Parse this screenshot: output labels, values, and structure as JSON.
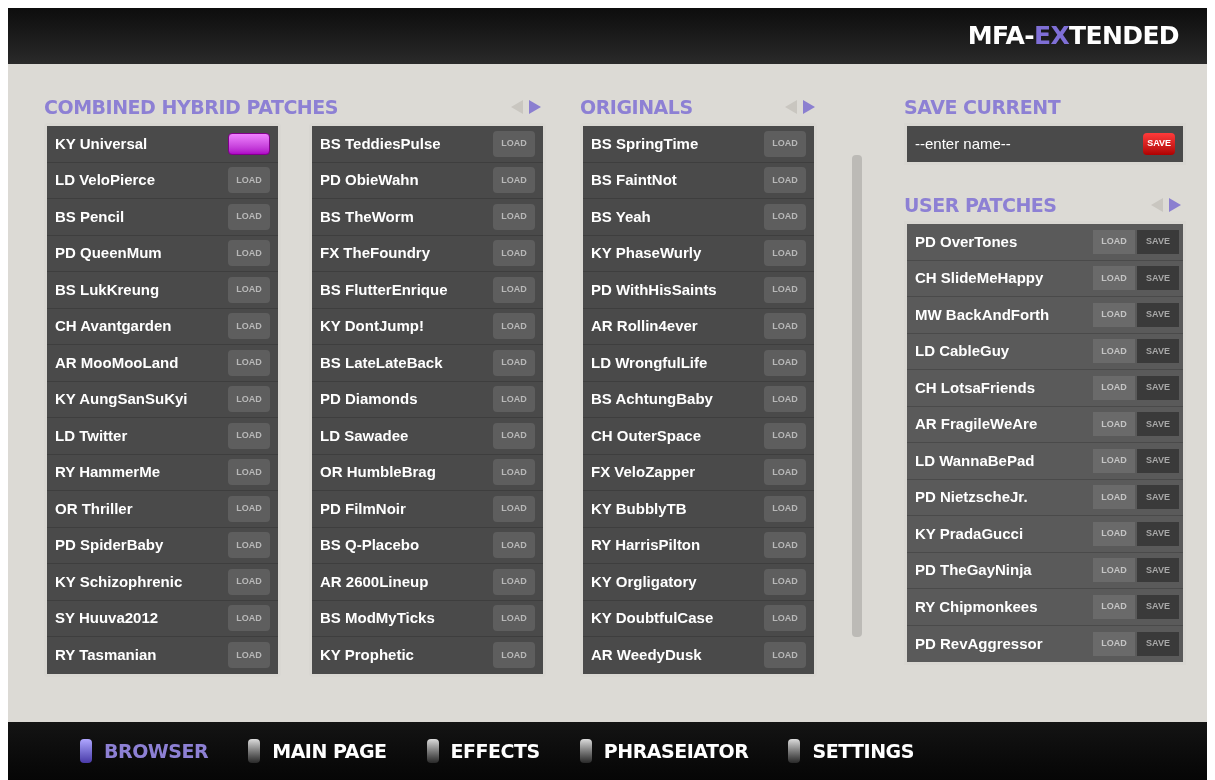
{
  "brand": {
    "prefix": "MFA-",
    "highlight": "EX",
    "suffix": "TENDED"
  },
  "combined": {
    "title": "COMBINED HYBRID PATCHES",
    "columns": [
      [
        {
          "name": "KY Universal",
          "selected": true
        },
        {
          "name": "LD VeloPierce",
          "selected": false,
          "load": "LOAD"
        },
        {
          "name": "BS Pencil",
          "selected": false,
          "load": "LOAD"
        },
        {
          "name": "PD QueenMum",
          "selected": false,
          "load": "LOAD"
        },
        {
          "name": "BS LukKreung",
          "selected": false,
          "load": "LOAD"
        },
        {
          "name": "CH Avantgarden",
          "selected": false,
          "load": "LOAD"
        },
        {
          "name": "AR MooMooLand",
          "selected": false,
          "load": "LOAD"
        },
        {
          "name": "KY AungSanSuKyi",
          "selected": false,
          "load": "LOAD"
        },
        {
          "name": "LD Twitter",
          "selected": false,
          "load": "LOAD"
        },
        {
          "name": "RY HammerMe",
          "selected": false,
          "load": "LOAD"
        },
        {
          "name": "OR Thriller",
          "selected": false,
          "load": "LOAD"
        },
        {
          "name": "PD SpiderBaby",
          "selected": false,
          "load": "LOAD"
        },
        {
          "name": "KY Schizophrenic",
          "selected": false,
          "load": "LOAD"
        },
        {
          "name": "SY Huuva2012",
          "selected": false,
          "load": "LOAD"
        },
        {
          "name": "RY Tasmanian",
          "selected": false,
          "load": "LOAD"
        }
      ],
      [
        {
          "name": "BS TeddiesPulse",
          "selected": false,
          "load": "LOAD"
        },
        {
          "name": "PD ObieWahn",
          "selected": false,
          "load": "LOAD"
        },
        {
          "name": "BS TheWorm",
          "selected": false,
          "load": "LOAD"
        },
        {
          "name": "FX TheFoundry",
          "selected": false,
          "load": "LOAD"
        },
        {
          "name": "BS FlutterEnrique",
          "selected": false,
          "load": "LOAD"
        },
        {
          "name": "KY DontJump!",
          "selected": false,
          "load": "LOAD"
        },
        {
          "name": "BS LateLateBack",
          "selected": false,
          "load": "LOAD"
        },
        {
          "name": "PD Diamonds",
          "selected": false,
          "load": "LOAD"
        },
        {
          "name": "LD Sawadee",
          "selected": false,
          "load": "LOAD"
        },
        {
          "name": "OR HumbleBrag",
          "selected": false,
          "load": "LOAD"
        },
        {
          "name": "PD FilmNoir",
          "selected": false,
          "load": "LOAD"
        },
        {
          "name": "BS Q-Placebo",
          "selected": false,
          "load": "LOAD"
        },
        {
          "name": "AR 2600Lineup",
          "selected": false,
          "load": "LOAD"
        },
        {
          "name": "BS ModMyTicks",
          "selected": false,
          "load": "LOAD"
        },
        {
          "name": "KY Prophetic",
          "selected": false,
          "load": "LOAD"
        }
      ]
    ]
  },
  "originals": {
    "title": "ORIGINALS",
    "rows": [
      {
        "name": "BS SpringTime",
        "selected": false,
        "load": "LOAD"
      },
      {
        "name": "BS FaintNot",
        "selected": false,
        "load": "LOAD"
      },
      {
        "name": "BS Yeah",
        "selected": false,
        "load": "LOAD"
      },
      {
        "name": "KY PhaseWurly",
        "selected": false,
        "load": "LOAD"
      },
      {
        "name": "PD WithHisSaints",
        "selected": false,
        "load": "LOAD"
      },
      {
        "name": "AR Rollin4ever",
        "selected": false,
        "load": "LOAD"
      },
      {
        "name": "LD WrongfulLife",
        "selected": false,
        "load": "LOAD"
      },
      {
        "name": "BS AchtungBaby",
        "selected": false,
        "load": "LOAD"
      },
      {
        "name": "CH OuterSpace",
        "selected": false,
        "load": "LOAD"
      },
      {
        "name": "FX VeloZapper",
        "selected": false,
        "load": "LOAD"
      },
      {
        "name": "KY BubblyTB",
        "selected": false,
        "load": "LOAD"
      },
      {
        "name": "RY HarrisPilton",
        "selected": false,
        "load": "LOAD"
      },
      {
        "name": "KY Orgligatory",
        "selected": false,
        "load": "LOAD"
      },
      {
        "name": "KY DoubtfulCase",
        "selected": false,
        "load": "LOAD"
      },
      {
        "name": "AR WeedyDusk",
        "selected": false,
        "load": "LOAD"
      }
    ]
  },
  "save_current": {
    "title": "SAVE CURRENT",
    "placeholder": "--enter name--",
    "button": "SAVE"
  },
  "user_patches": {
    "title": "USER PATCHES",
    "rows": [
      {
        "name": "PD OverTones",
        "load": "LOAD",
        "save": "SAVE"
      },
      {
        "name": "CH SlideMeHappy",
        "load": "LOAD",
        "save": "SAVE"
      },
      {
        "name": "MW BackAndForth",
        "load": "LOAD",
        "save": "SAVE"
      },
      {
        "name": "LD CableGuy",
        "load": "LOAD",
        "save": "SAVE"
      },
      {
        "name": "CH LotsaFriends",
        "load": "LOAD",
        "save": "SAVE"
      },
      {
        "name": "AR FragileWeAre",
        "load": "LOAD",
        "save": "SAVE"
      },
      {
        "name": "LD WannaBePad",
        "load": "LOAD",
        "save": "SAVE"
      },
      {
        "name": "PD NietzscheJr.",
        "load": "LOAD",
        "save": "SAVE"
      },
      {
        "name": "KY PradaGucci",
        "load": "LOAD",
        "save": "SAVE"
      },
      {
        "name": "PD TheGayNinja",
        "load": "LOAD",
        "save": "SAVE"
      },
      {
        "name": "RY Chipmonkees",
        "load": "LOAD",
        "save": "SAVE"
      },
      {
        "name": "PD RevAggressor",
        "load": "LOAD",
        "save": "SAVE"
      }
    ]
  },
  "nav": [
    {
      "label": "BROWSER",
      "selected": true
    },
    {
      "label": "MAIN PAGE",
      "selected": false
    },
    {
      "label": "EFFECTS",
      "selected": false
    },
    {
      "label": "PHRASEIATOR",
      "selected": false
    },
    {
      "label": "SETTINGS",
      "selected": false
    }
  ]
}
